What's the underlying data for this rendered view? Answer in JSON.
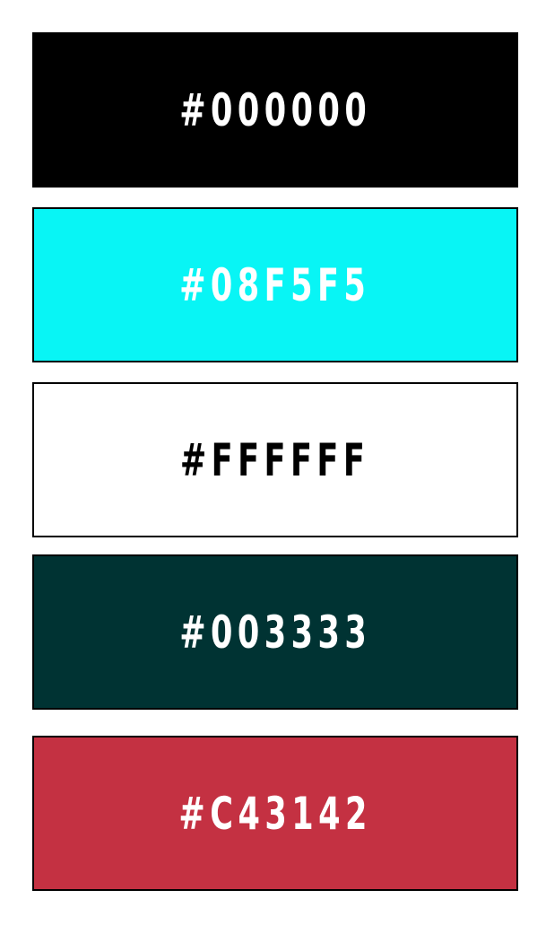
{
  "palette": {
    "swatches": [
      {
        "label": "#000000",
        "background": "#000000",
        "text_color": "#ffffff"
      },
      {
        "label": "#08F5F5",
        "background": "#08f5f5",
        "text_color": "#ffffff"
      },
      {
        "label": "#FFFFFF",
        "background": "#ffffff",
        "text_color": "#000000"
      },
      {
        "label": "#003333",
        "background": "#003333",
        "text_color": "#ffffff"
      },
      {
        "label": "#C43142",
        "background": "#c43142",
        "text_color": "#ffffff"
      }
    ]
  }
}
